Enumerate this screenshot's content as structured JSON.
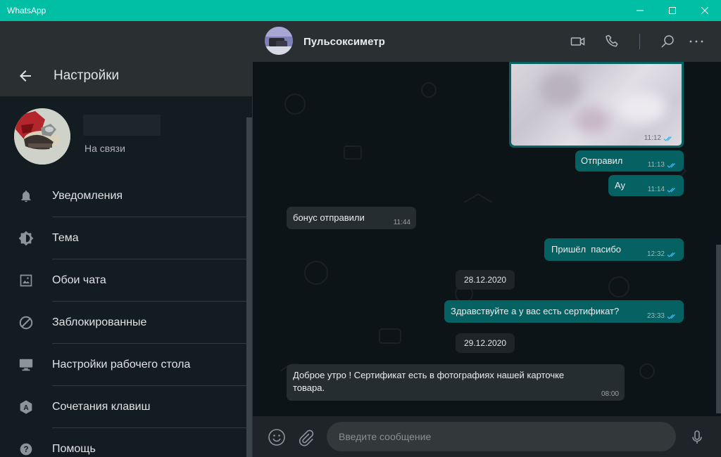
{
  "window": {
    "title": "WhatsApp",
    "titlebar_color": "#00bfa5",
    "controls": [
      "minimize-icon",
      "maximize-icon",
      "close-icon"
    ]
  },
  "settings": {
    "title": "Настройки",
    "profile": {
      "status": "На связи"
    },
    "menu": [
      {
        "icon": "bell-icon",
        "label": "Уведомления"
      },
      {
        "icon": "theme-icon",
        "label": "Тема"
      },
      {
        "icon": "wallpaper-icon",
        "label": "Обои чата"
      },
      {
        "icon": "blocked-icon",
        "label": "Заблокированные"
      },
      {
        "icon": "desktop-icon",
        "label": "Настройки рабочего стола"
      },
      {
        "icon": "keyboard-shortcuts-icon",
        "label": "Сочетания клавиш"
      },
      {
        "icon": "help-icon",
        "label": "Помощь"
      }
    ]
  },
  "chat": {
    "name": "Пульсоксиметр",
    "header_icons": [
      "video-call-icon",
      "voice-call-icon",
      "search-icon",
      "more-options-icon"
    ],
    "messages": [
      {
        "type": "photo",
        "direction": "out",
        "time": "11:12"
      },
      {
        "direction": "out",
        "text": "Отправил",
        "time": "11:13"
      },
      {
        "direction": "out",
        "text": "Ау",
        "time": "11:14"
      },
      {
        "direction": "in",
        "text": "бонус отправили",
        "time": "11:44"
      },
      {
        "direction": "out",
        "text": "Пришёл  пасибо",
        "time": "12:32"
      },
      {
        "type": "date",
        "text": "28.12.2020"
      },
      {
        "direction": "out",
        "text": "Здравствуйте а у вас есть сертификат?",
        "time": "23:33"
      },
      {
        "type": "date",
        "text": "29.12.2020"
      },
      {
        "direction": "in",
        "text": "Доброе утро ! Сертификат есть в фотографиях нашей карточке товара.",
        "time": "08:00"
      }
    ],
    "composer": {
      "placeholder": "Введите сообщение",
      "icons": [
        "emoji-icon",
        "attach-icon",
        "microphone-icon"
      ]
    },
    "colors": {
      "outgoing_bubble": "#056162",
      "incoming_bubble": "#262d31",
      "read_ticks": "#34b7f1"
    }
  }
}
